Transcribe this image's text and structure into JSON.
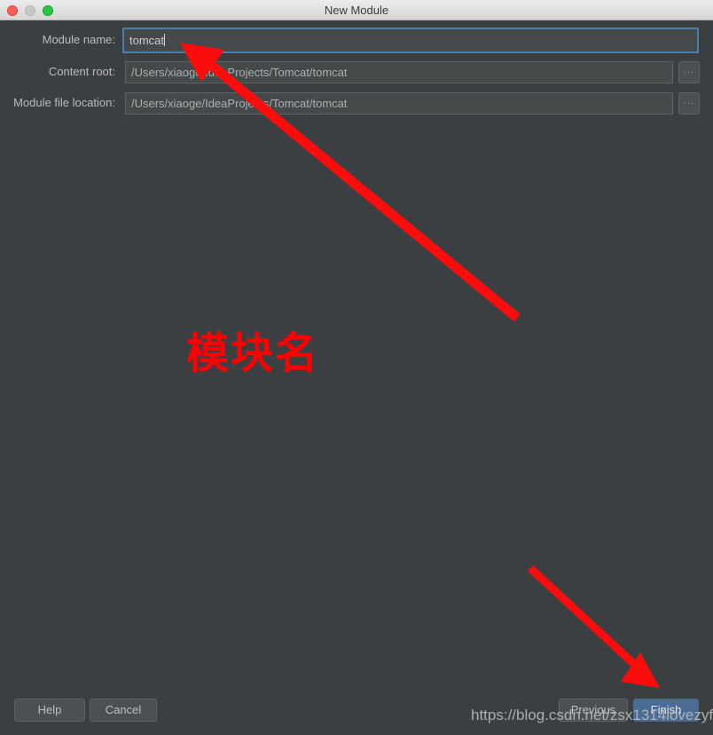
{
  "window": {
    "title": "New Module",
    "traffic_lights": [
      {
        "name": "close",
        "color": "#ff5f57"
      },
      {
        "name": "minimize",
        "color": "#c7c7c7"
      },
      {
        "name": "maximize",
        "color": "#28c840"
      }
    ],
    "background_color": "#3c3f41"
  },
  "form": {
    "fields": [
      {
        "label": "Module name:",
        "value": "tomcat",
        "placeholder": "",
        "focused": true,
        "has_browse": false
      },
      {
        "label": "Content root:",
        "value": "/Users/xiaoge/IdeaProjects/Tomcat/tomcat",
        "placeholder": "",
        "focused": false,
        "has_browse": true
      },
      {
        "label": "Module file location:",
        "value": "/Users/xiaoge/IdeaProjects/Tomcat/tomcat",
        "placeholder": "",
        "focused": false,
        "has_browse": true
      }
    ],
    "browse_label": "..."
  },
  "footer": {
    "help_label": "Help",
    "cancel_label": "Cancel",
    "previous_label": "Previous",
    "finish_label": "Finish",
    "finish_accent": "#4a6c94"
  },
  "annotations": {
    "chinese_note": "模块名",
    "note_color": "#ff0000",
    "arrow_color": "#fb0d0d",
    "watermark": "https://blog.csdn.net/zsx1314lovezyf"
  }
}
